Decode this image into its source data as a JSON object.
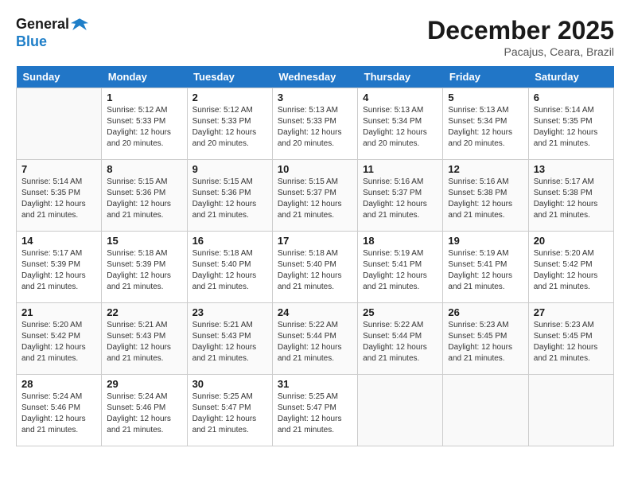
{
  "header": {
    "logo_line1": "General",
    "logo_line2": "Blue",
    "month_title": "December 2025",
    "location": "Pacajus, Ceara, Brazil"
  },
  "weekdays": [
    "Sunday",
    "Monday",
    "Tuesday",
    "Wednesday",
    "Thursday",
    "Friday",
    "Saturday"
  ],
  "weeks": [
    [
      {
        "day": "",
        "sunrise": "",
        "sunset": "",
        "daylight": ""
      },
      {
        "day": "1",
        "sunrise": "Sunrise: 5:12 AM",
        "sunset": "Sunset: 5:33 PM",
        "daylight": "Daylight: 12 hours and 20 minutes."
      },
      {
        "day": "2",
        "sunrise": "Sunrise: 5:12 AM",
        "sunset": "Sunset: 5:33 PM",
        "daylight": "Daylight: 12 hours and 20 minutes."
      },
      {
        "day": "3",
        "sunrise": "Sunrise: 5:13 AM",
        "sunset": "Sunset: 5:33 PM",
        "daylight": "Daylight: 12 hours and 20 minutes."
      },
      {
        "day": "4",
        "sunrise": "Sunrise: 5:13 AM",
        "sunset": "Sunset: 5:34 PM",
        "daylight": "Daylight: 12 hours and 20 minutes."
      },
      {
        "day": "5",
        "sunrise": "Sunrise: 5:13 AM",
        "sunset": "Sunset: 5:34 PM",
        "daylight": "Daylight: 12 hours and 20 minutes."
      },
      {
        "day": "6",
        "sunrise": "Sunrise: 5:14 AM",
        "sunset": "Sunset: 5:35 PM",
        "daylight": "Daylight: 12 hours and 21 minutes."
      }
    ],
    [
      {
        "day": "7",
        "sunrise": "Sunrise: 5:14 AM",
        "sunset": "Sunset: 5:35 PM",
        "daylight": "Daylight: 12 hours and 21 minutes."
      },
      {
        "day": "8",
        "sunrise": "Sunrise: 5:15 AM",
        "sunset": "Sunset: 5:36 PM",
        "daylight": "Daylight: 12 hours and 21 minutes."
      },
      {
        "day": "9",
        "sunrise": "Sunrise: 5:15 AM",
        "sunset": "Sunset: 5:36 PM",
        "daylight": "Daylight: 12 hours and 21 minutes."
      },
      {
        "day": "10",
        "sunrise": "Sunrise: 5:15 AM",
        "sunset": "Sunset: 5:37 PM",
        "daylight": "Daylight: 12 hours and 21 minutes."
      },
      {
        "day": "11",
        "sunrise": "Sunrise: 5:16 AM",
        "sunset": "Sunset: 5:37 PM",
        "daylight": "Daylight: 12 hours and 21 minutes."
      },
      {
        "day": "12",
        "sunrise": "Sunrise: 5:16 AM",
        "sunset": "Sunset: 5:38 PM",
        "daylight": "Daylight: 12 hours and 21 minutes."
      },
      {
        "day": "13",
        "sunrise": "Sunrise: 5:17 AM",
        "sunset": "Sunset: 5:38 PM",
        "daylight": "Daylight: 12 hours and 21 minutes."
      }
    ],
    [
      {
        "day": "14",
        "sunrise": "Sunrise: 5:17 AM",
        "sunset": "Sunset: 5:39 PM",
        "daylight": "Daylight: 12 hours and 21 minutes."
      },
      {
        "day": "15",
        "sunrise": "Sunrise: 5:18 AM",
        "sunset": "Sunset: 5:39 PM",
        "daylight": "Daylight: 12 hours and 21 minutes."
      },
      {
        "day": "16",
        "sunrise": "Sunrise: 5:18 AM",
        "sunset": "Sunset: 5:40 PM",
        "daylight": "Daylight: 12 hours and 21 minutes."
      },
      {
        "day": "17",
        "sunrise": "Sunrise: 5:18 AM",
        "sunset": "Sunset: 5:40 PM",
        "daylight": "Daylight: 12 hours and 21 minutes."
      },
      {
        "day": "18",
        "sunrise": "Sunrise: 5:19 AM",
        "sunset": "Sunset: 5:41 PM",
        "daylight": "Daylight: 12 hours and 21 minutes."
      },
      {
        "day": "19",
        "sunrise": "Sunrise: 5:19 AM",
        "sunset": "Sunset: 5:41 PM",
        "daylight": "Daylight: 12 hours and 21 minutes."
      },
      {
        "day": "20",
        "sunrise": "Sunrise: 5:20 AM",
        "sunset": "Sunset: 5:42 PM",
        "daylight": "Daylight: 12 hours and 21 minutes."
      }
    ],
    [
      {
        "day": "21",
        "sunrise": "Sunrise: 5:20 AM",
        "sunset": "Sunset: 5:42 PM",
        "daylight": "Daylight: 12 hours and 21 minutes."
      },
      {
        "day": "22",
        "sunrise": "Sunrise: 5:21 AM",
        "sunset": "Sunset: 5:43 PM",
        "daylight": "Daylight: 12 hours and 21 minutes."
      },
      {
        "day": "23",
        "sunrise": "Sunrise: 5:21 AM",
        "sunset": "Sunset: 5:43 PM",
        "daylight": "Daylight: 12 hours and 21 minutes."
      },
      {
        "day": "24",
        "sunrise": "Sunrise: 5:22 AM",
        "sunset": "Sunset: 5:44 PM",
        "daylight": "Daylight: 12 hours and 21 minutes."
      },
      {
        "day": "25",
        "sunrise": "Sunrise: 5:22 AM",
        "sunset": "Sunset: 5:44 PM",
        "daylight": "Daylight: 12 hours and 21 minutes."
      },
      {
        "day": "26",
        "sunrise": "Sunrise: 5:23 AM",
        "sunset": "Sunset: 5:45 PM",
        "daylight": "Daylight: 12 hours and 21 minutes."
      },
      {
        "day": "27",
        "sunrise": "Sunrise: 5:23 AM",
        "sunset": "Sunset: 5:45 PM",
        "daylight": "Daylight: 12 hours and 21 minutes."
      }
    ],
    [
      {
        "day": "28",
        "sunrise": "Sunrise: 5:24 AM",
        "sunset": "Sunset: 5:46 PM",
        "daylight": "Daylight: 12 hours and 21 minutes."
      },
      {
        "day": "29",
        "sunrise": "Sunrise: 5:24 AM",
        "sunset": "Sunset: 5:46 PM",
        "daylight": "Daylight: 12 hours and 21 minutes."
      },
      {
        "day": "30",
        "sunrise": "Sunrise: 5:25 AM",
        "sunset": "Sunset: 5:47 PM",
        "daylight": "Daylight: 12 hours and 21 minutes."
      },
      {
        "day": "31",
        "sunrise": "Sunrise: 5:25 AM",
        "sunset": "Sunset: 5:47 PM",
        "daylight": "Daylight: 12 hours and 21 minutes."
      },
      {
        "day": "",
        "sunrise": "",
        "sunset": "",
        "daylight": ""
      },
      {
        "day": "",
        "sunrise": "",
        "sunset": "",
        "daylight": ""
      },
      {
        "day": "",
        "sunrise": "",
        "sunset": "",
        "daylight": ""
      }
    ]
  ]
}
